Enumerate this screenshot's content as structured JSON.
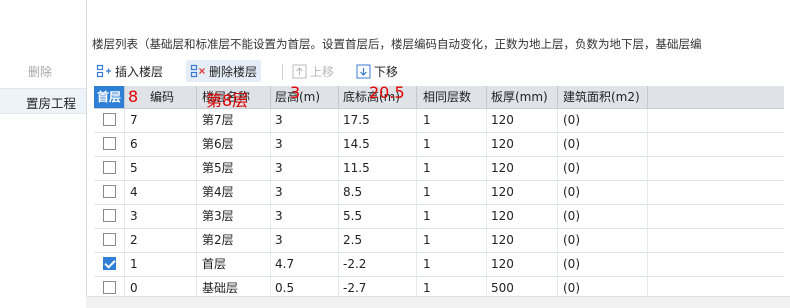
{
  "left_panel": {
    "delete_label": "删除",
    "selected_item": "置房工程"
  },
  "notice": "楼层列表（基础层和标准层不能设置为首层。设置首层后，楼层编码自动变化，正数为地上层，负数为地下层，基础层编",
  "toolbar": {
    "insert_label": "插入楼层",
    "delete_label": "删除楼层",
    "up_label": "上移",
    "down_label": "下移"
  },
  "table": {
    "headers": {
      "first_floor": "首层",
      "code": "编码",
      "name": "楼层名称",
      "height": "层高(m)",
      "bottom_elev": "底标高(m)",
      "same_count": "相同层数",
      "slab": "板厚(mm)",
      "area": "建筑面积(m2)"
    },
    "overlays": {
      "code": "8",
      "name": "第8层",
      "height": "3",
      "bottom_elev": "20.5"
    },
    "rows": [
      {
        "checked": false,
        "code": "7",
        "name": "第7层",
        "height": "3",
        "bottom_elev": "17.5",
        "same_count": "1",
        "slab": "120",
        "area": "(0)"
      },
      {
        "checked": false,
        "code": "6",
        "name": "第6层",
        "height": "3",
        "bottom_elev": "14.5",
        "same_count": "1",
        "slab": "120",
        "area": "(0)"
      },
      {
        "checked": false,
        "code": "5",
        "name": "第5层",
        "height": "3",
        "bottom_elev": "11.5",
        "same_count": "1",
        "slab": "120",
        "area": "(0)"
      },
      {
        "checked": false,
        "code": "4",
        "name": "第4层",
        "height": "3",
        "bottom_elev": "8.5",
        "same_count": "1",
        "slab": "120",
        "area": "(0)"
      },
      {
        "checked": false,
        "code": "3",
        "name": "第3层",
        "height": "3",
        "bottom_elev": "5.5",
        "same_count": "1",
        "slab": "120",
        "area": "(0)"
      },
      {
        "checked": false,
        "code": "2",
        "name": "第2层",
        "height": "3",
        "bottom_elev": "2.5",
        "same_count": "1",
        "slab": "120",
        "area": "(0)"
      },
      {
        "checked": true,
        "code": "1",
        "name": "首层",
        "height": "4.7",
        "bottom_elev": "-2.2",
        "same_count": "1",
        "slab": "120",
        "area": "(0)"
      },
      {
        "checked": false,
        "code": "0",
        "name": "基础层",
        "height": "0.5",
        "bottom_elev": "-2.7",
        "same_count": "1",
        "slab": "500",
        "area": "(0)"
      }
    ]
  },
  "colors": {
    "accent": "#2f7fd6",
    "overlay": "#e00000",
    "header_bg": "#dfe3e8"
  }
}
